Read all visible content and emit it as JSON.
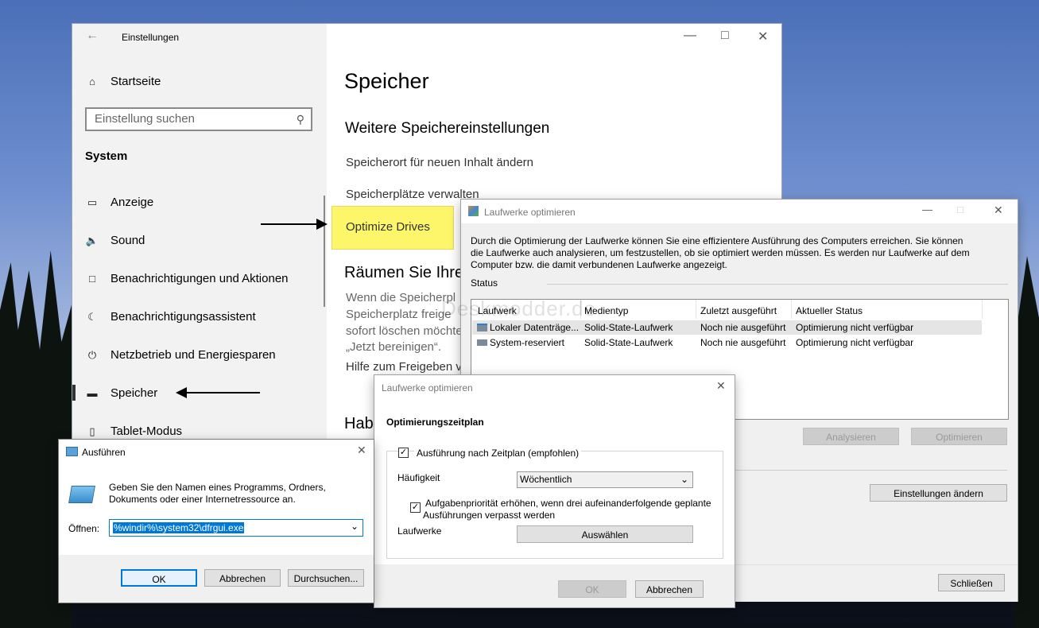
{
  "settings": {
    "title": "Einstellungen",
    "home": "Startseite",
    "search_placeholder": "Einstellung suchen",
    "section": "System",
    "nav": [
      "Anzeige",
      "Sound",
      "Benachrichtigungen und Aktionen",
      "Benachrichtigungsassistent",
      "Netzbetrieb und Energiesparen",
      "Speicher",
      "Tablet-Modus"
    ],
    "page_title": "Speicher",
    "more_heading": "Weitere Speichereinstellungen",
    "link1": "Speicherort für neuen Inhalt ändern",
    "link2": "Speicherplätze verwalten",
    "optimize": "Optimize Drives",
    "clean_heading": "Räumen Sie Ihre",
    "clean_lines": [
      "Wenn die Speicherpl",
      "Speicherplatz freige",
      "sofort löschen möchte",
      "„Jetzt bereinigen“."
    ],
    "help": "Hilfe zum Freigeben v",
    "habe": "Habe"
  },
  "defrag": {
    "title": "Laufwerke optimieren",
    "description": "Durch die Optimierung der Laufwerke können Sie eine effizientere Ausführung des Computers erreichen. Sie können die Laufwerke auch analysieren, um festzustellen, ob sie optimiert werden müssen. Es werden nur Laufwerke auf dem Computer bzw. die damit verbundenen Laufwerke angezeigt.",
    "status_label": "Status",
    "columns": [
      "Laufwerk",
      "Medientyp",
      "Zuletzt ausgeführt",
      "Aktueller Status"
    ],
    "rows": [
      [
        "Lokaler Datenträge...",
        "Solid-State-Laufwerk",
        "Noch nie ausgeführt",
        "Optimierung nicht verfügbar"
      ],
      [
        "System-reserviert",
        "Solid-State-Laufwerk",
        "Noch nie ausgeführt",
        "Optimierung nicht verfügbar"
      ]
    ],
    "analyze": "Analysieren",
    "optimize": "Optimieren",
    "change_settings": "Einstellungen ändern",
    "close": "Schließen"
  },
  "schedule": {
    "title": "Laufwerke optimieren",
    "heading": "Optimierungszeitplan",
    "run_on_schedule": "Ausführung nach Zeitplan (empfohlen)",
    "frequency_label": "Häufigkeit",
    "frequency_value": "Wöchentlich",
    "priority_text": "Aufgabenpriorität erhöhen, wenn drei aufeinanderfolgende geplante Ausführungen verpasst werden",
    "drives_label": "Laufwerke",
    "select": "Auswählen",
    "ok": "OK",
    "cancel": "Abbrechen"
  },
  "run": {
    "title": "Ausführen",
    "description": "Geben Sie den Namen eines Programms, Ordners, Dokuments oder einer Internetressource an.",
    "open_label": "Öffnen:",
    "command": "%windir%\\system32\\dfrgui.exe",
    "ok": "OK",
    "cancel": "Abbrechen",
    "browse": "Durchsuchen..."
  },
  "watermark": "Deskmodder.de",
  "colors": {
    "highlight": "#fdf66b",
    "selection": "#0078d7"
  }
}
